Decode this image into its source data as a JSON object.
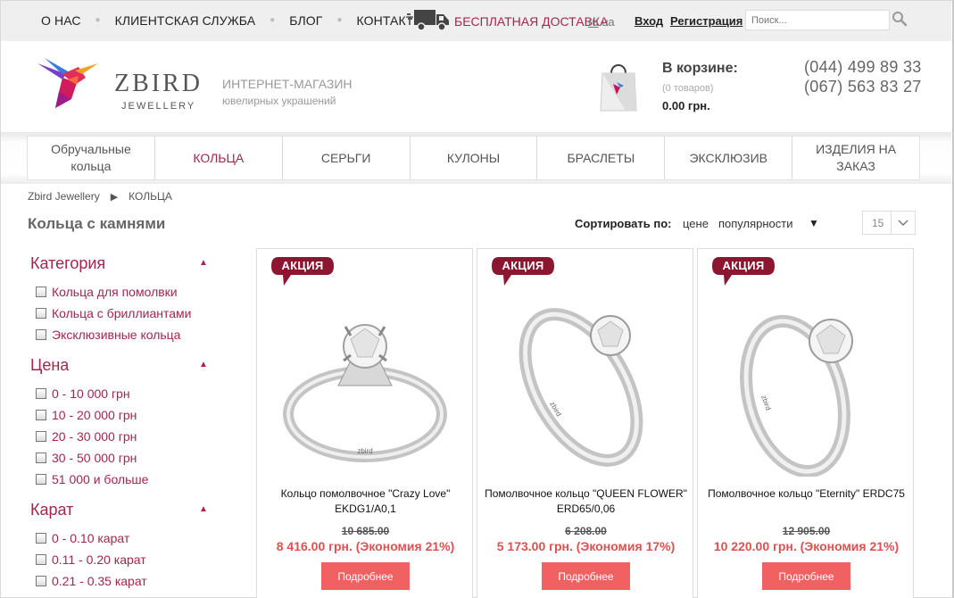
{
  "topnav": {
    "items": [
      "О НАС",
      "КЛИЕНТСКАЯ СЛУЖБА",
      "БЛОГ",
      "КОНТАКТЫ"
    ],
    "free_shipping": "БЕСПЛАТНАЯ ДОСТАВКА",
    "lang_ru": "ru",
    "lang_ua": "ua",
    "login": "Вход",
    "register": "Регистрация",
    "search_placeholder": "Поиск..."
  },
  "header": {
    "brand": "ZBIRD",
    "brand_sub": "JEWELLERY",
    "tagline1": "ИНТЕРНЕТ-МАГАЗИН",
    "tagline2": "ювелирных украшений",
    "cart_title": "В корзине:",
    "cart_count": "(0 товаров)",
    "cart_total": "0.00 грн.",
    "phones": [
      "(044) 499 89 33",
      "(067) 563 83 27"
    ]
  },
  "nav": {
    "items": [
      {
        "label": "Обручальные кольца",
        "active": false
      },
      {
        "label": "КОЛЬЦА",
        "active": true
      },
      {
        "label": "СЕРЬГИ",
        "active": false
      },
      {
        "label": "КУЛОНЫ",
        "active": false
      },
      {
        "label": "БРАСЛЕТЫ",
        "active": false
      },
      {
        "label": "ЭКСКЛЮЗИВ",
        "active": false
      },
      {
        "label": "ИЗДЕЛИЯ НА ЗАКАЗ",
        "active": false
      }
    ]
  },
  "breadcrumb": {
    "home": "Zbird Jewellery",
    "separator": "▶",
    "current": "КОЛЬЦА"
  },
  "page_title": "Кольца с камнями",
  "sort": {
    "label": "Сортировать по:",
    "options": [
      "цене",
      "популярности"
    ],
    "arrow": "▼",
    "per_page": "15"
  },
  "filters": {
    "category": {
      "title": "Категория",
      "options": [
        "Кольца для помолвки",
        "Кольца с бриллиантами",
        "Эксклюзивные кольца"
      ]
    },
    "price": {
      "title": "Цена",
      "options": [
        "0 - 10 000 грн",
        "10 - 20 000 грн",
        "20 - 30 000 грн",
        "30 - 50 000 грн",
        "51 000 и больше"
      ]
    },
    "carat": {
      "title": "Карат",
      "options": [
        "0 - 0.10 карат",
        "0.11 - 0.20 карат",
        "0.21 - 0.35 карат"
      ]
    }
  },
  "products": [
    {
      "badge": "АКЦИЯ",
      "name": "Кольцо помолвочное \"Crazy Love\" EKDG1/A0,1",
      "old_price": "10 685.00",
      "new_price": "8 416.00 грн. (Экономия 21%)",
      "button": "Подробнее"
    },
    {
      "badge": "АКЦИЯ",
      "name": "Помолвочное кольцо \"QUEEN FLOWER\" ERD65/0,06",
      "old_price": "6 208.00",
      "new_price": "5 173.00 грн. (Экономия 17%)",
      "button": "Подробнее"
    },
    {
      "badge": "АКЦИЯ",
      "name": "Помолвочное кольцо \"Eternity\" ERDC75",
      "old_price": "12 905.00",
      "new_price": "10 220.00 грн. (Экономия 21%)",
      "button": "Подробнее"
    }
  ],
  "colors": {
    "accent": "#a3264d",
    "sale": "#f26161",
    "badge": "#8c1530"
  }
}
